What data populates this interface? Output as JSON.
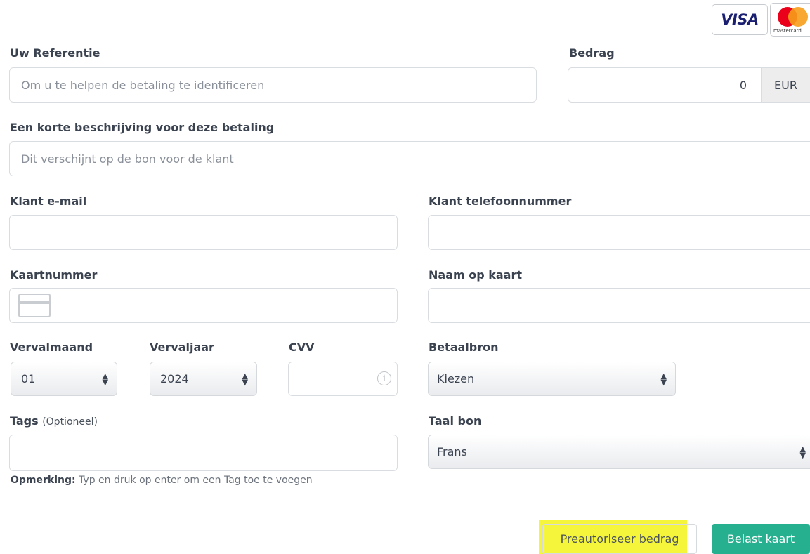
{
  "header": {
    "visa_logo": "VISA",
    "mastercard_logo": "mastercard"
  },
  "reference": {
    "label": "Uw Referentie",
    "placeholder": "Om u te helpen de betaling te identificeren"
  },
  "amount": {
    "label": "Bedrag",
    "value": "0",
    "currency": "EUR"
  },
  "description": {
    "label": "Een korte beschrijving voor deze betaling",
    "placeholder": "Dit verschijnt op de bon voor de klant"
  },
  "customer_email": {
    "label": "Klant e-mail",
    "value": ""
  },
  "customer_phone": {
    "label": "Klant telefoonnummer",
    "value": ""
  },
  "card_number": {
    "label": "Kaartnummer",
    "value": ""
  },
  "card_name": {
    "label": "Naam op kaart",
    "value": ""
  },
  "expiry_month": {
    "label": "Vervalmaand",
    "value": "01"
  },
  "expiry_year": {
    "label": "Vervaljaar",
    "value": "2024"
  },
  "cvv": {
    "label": "CVV",
    "value": ""
  },
  "payment_source": {
    "label": "Betaalbron",
    "value": "Kiezen"
  },
  "tags": {
    "label": "Tags",
    "optional": "(Optioneel)",
    "note_bold": "Opmerking:",
    "note_text": " Typ en druk op enter om een Tag toe te voegen"
  },
  "receipt_language": {
    "label": "Taal bon",
    "value": "Frans"
  },
  "actions": {
    "preauthorize_label": "Preautoriseer bedrag",
    "charge_label": "Belast kaart"
  },
  "colors": {
    "primary_button": "#27b08f",
    "highlight": "#f5f53c",
    "mastercard_red": "#eb001b",
    "mastercard_orange": "#f79e1b",
    "visa_blue": "#1a1f71"
  }
}
